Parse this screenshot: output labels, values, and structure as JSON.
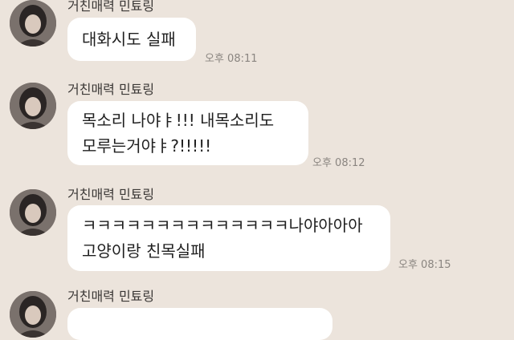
{
  "messages": [
    {
      "sender": "거친매력 민툐링",
      "lines": [
        "대화시도 실패"
      ],
      "time": "오후 08:11"
    },
    {
      "sender": "거친매력 민툐링",
      "lines": [
        "목소리 나야ㅑ!!! 내목소리도",
        "모루는거야ㅑ?!!!!!"
      ],
      "time": "오후 08:12"
    },
    {
      "sender": "거친매력 민툐링",
      "lines": [
        "ㅋㅋㅋㅋㅋㅋㅋㅋㅋㅋㅋㅋㅋㅋ나야아아아",
        "고양이랑 친목실패"
      ],
      "time": "오후 08:15"
    },
    {
      "sender": "거친매력 민툐링",
      "lines": [],
      "time": ""
    }
  ]
}
